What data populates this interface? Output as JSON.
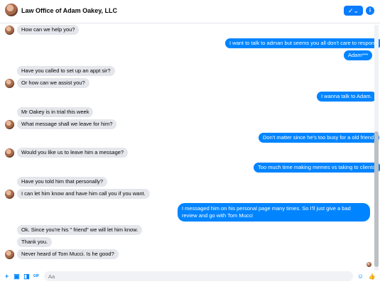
{
  "header": {
    "title": "Law Office of Adam Oakey, LLC",
    "status_button": "✓⌄",
    "info_button": "i"
  },
  "messages": [
    {
      "side": "in",
      "text": "How can we help you?"
    },
    {
      "side": "out",
      "text": "I want to talk to adman but seems you all don't care to respond"
    },
    {
      "side": "out",
      "text": "Adam***"
    },
    {
      "side": "in",
      "text": "Have you called to set up an appt sir?"
    },
    {
      "side": "in",
      "text": "Or how can we assist you?"
    },
    {
      "side": "out",
      "text": "I wanna talk to Adam."
    },
    {
      "side": "in",
      "text": "Mr Oakey is in trial this week"
    },
    {
      "side": "in",
      "text": "What message shall we leave for him?"
    },
    {
      "side": "out",
      "text": "Don't matter since he's too busy for a old friend."
    },
    {
      "side": "in",
      "text": "Would you like us to leave him a message?"
    },
    {
      "side": "out",
      "text": "Too much time making memes vs taking to clients."
    },
    {
      "side": "in",
      "text": "Have you told him that personally?"
    },
    {
      "side": "in",
      "text": "I can let him know and have him call you if you want."
    },
    {
      "side": "out",
      "text": "I messaged him on his personal page many times.  So I'll just give a bad review and go with Tom Mucci"
    },
    {
      "side": "in",
      "text": "Ok.  Since you're his \" friend\" we will let him know."
    },
    {
      "side": "in",
      "text": "Thank you."
    },
    {
      "side": "in",
      "text": "Never heard of Tom Mucci. Is he good?"
    }
  ],
  "composer": {
    "placeholder": "Aa",
    "icons": [
      "plus-icon",
      "image-icon",
      "sticker-icon",
      "gif-icon",
      "emoji-icon",
      "like-icon"
    ],
    "icon_glyphs": {
      "plus": "+",
      "image": "▣",
      "sticker": "◨",
      "gif": "GIF",
      "emoji": "☺",
      "like": "👍"
    }
  },
  "colors": {
    "accent": "#0084ff",
    "incoming_bubble": "#e4e6eb",
    "outgoing_text": "#ffffff"
  }
}
